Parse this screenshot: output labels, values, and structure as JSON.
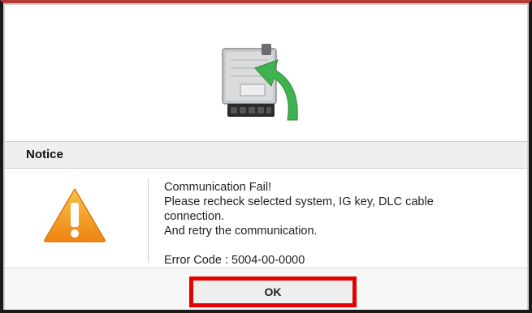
{
  "dialog": {
    "title": "Notice",
    "message_lines": [
      "Communication Fail!",
      "Please recheck selected system, IG key, DLC cable",
      "connection.",
      "And retry the communication."
    ],
    "error_code": "Error Code : 5004-00-0000",
    "ok_label": "OK"
  },
  "icons": {
    "hero": "ecu-module-with-green-arrow-icon",
    "warning": "warning-triangle-icon"
  },
  "colors": {
    "ok_highlight": "#e60000",
    "warning_orange": "#f39a1f",
    "arrow_green": "#3fb34f"
  }
}
